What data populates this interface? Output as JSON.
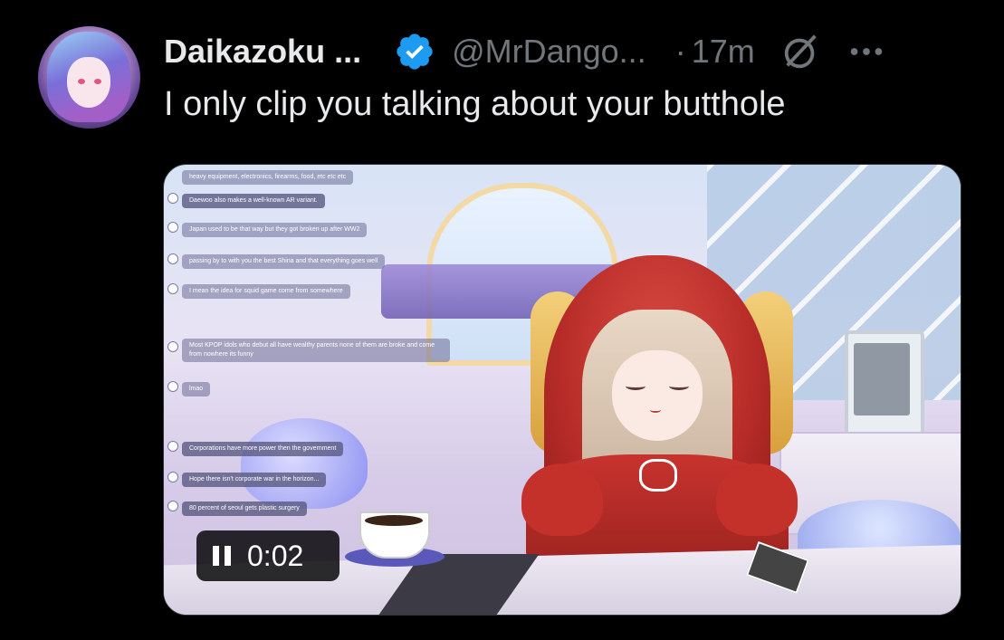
{
  "tweet": {
    "author": {
      "display_name": "Daikazoku ...",
      "handle": "@MrDango...",
      "verified": true,
      "avatar_icon": "anime-avatar"
    },
    "separator": "·",
    "time": "17m",
    "text": "I only clip you talking about your butthole",
    "actions": {
      "grok_icon": "grok-icon",
      "more_icon": "more-options-icon"
    }
  },
  "media": {
    "type": "video",
    "timecode": "0:02",
    "state": "playing",
    "chat_messages": [
      "heavy equipment, electronics, firearms, food, etc etc etc",
      "Daewoo also makes a well-known AR variant.",
      "Japan used to be that way but they got broken up after WW2",
      "passing by to with you the best Shina and that everything goes well",
      "I mean the idea for squid game come from somewhere",
      "Most KPOP idols who debut all have wealthy parents none of them are broke and come from nowhere its funny",
      "lmao",
      "Corporations have more power then the government",
      "Hope there isn't corporate war in the horizon...",
      "80 percent of seoul gets plastic surgery"
    ]
  },
  "colors": {
    "background": "#000000",
    "text_primary": "#e7e9ea",
    "text_secondary": "#71767b",
    "verified_blue": "#1d9bf0"
  }
}
